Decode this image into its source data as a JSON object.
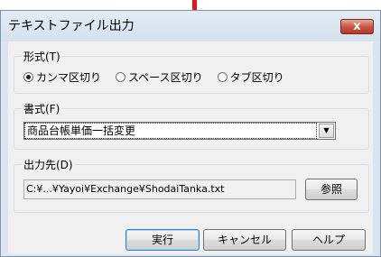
{
  "window": {
    "title": "テキストファイル出力",
    "close_glyph": "x"
  },
  "format": {
    "legend": "形式(T)",
    "options": [
      {
        "label": "カンマ区切り",
        "selected": true
      },
      {
        "label": "スペース区切り",
        "selected": false
      },
      {
        "label": "タブ区切り",
        "selected": false
      }
    ]
  },
  "style": {
    "legend": "書式(F)",
    "selected": "商品台帳単価一括変更",
    "dropdown_glyph": "▼"
  },
  "output": {
    "legend": "出力先(D)",
    "path": "C:¥...¥Yayoi¥Exchange¥ShodaiTanka.txt",
    "browse_label": "参照"
  },
  "buttons": {
    "execute": "実行",
    "cancel": "キャンセル",
    "help": "ヘルプ"
  },
  "colors": {
    "annotation_arrow": "#e8101a",
    "close_button": "#c8513d"
  },
  "annotation": {
    "icon": "red-down-arrow"
  }
}
